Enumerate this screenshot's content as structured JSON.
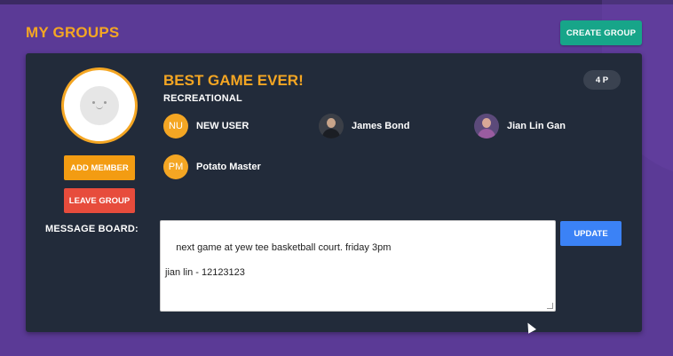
{
  "page": {
    "title": "MY GROUPS"
  },
  "header": {
    "create_group_label": "CREATE GROUP"
  },
  "group": {
    "name": "BEST GAME EVER!",
    "type": "RECREATIONAL",
    "member_count_badge": "4 P",
    "avatar_icon": "smiley-face-icon",
    "actions": {
      "add_member_label": "ADD MEMBER",
      "leave_group_label": "LEAVE GROUP"
    },
    "members": [
      {
        "name": "NEW USER",
        "initials": "NU",
        "avatar": "initials"
      },
      {
        "name": "James Bond",
        "initials": "",
        "avatar": "photo"
      },
      {
        "name": "Jian Lin Gan",
        "initials": "",
        "avatar": "photo"
      },
      {
        "name": "Potato Master",
        "initials": "PM",
        "avatar": "initials"
      }
    ],
    "message_board": {
      "label": "MESSAGE BOARD:",
      "text": "next game at yew tee basketball court. friday 3pm\n\njian lin - 12123123",
      "update_label": "UPDATE"
    }
  },
  "colors": {
    "background": "#5b3a96",
    "card": "#222b3a",
    "accent_orange": "#f4a623",
    "create_green": "#17a589",
    "leave_red": "#e74c3c",
    "update_blue": "#3b82f6"
  }
}
